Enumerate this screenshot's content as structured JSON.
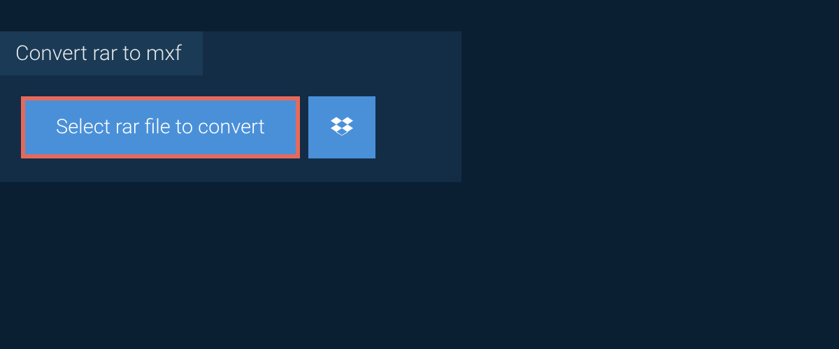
{
  "tab": {
    "title": "Convert rar to mxf"
  },
  "actions": {
    "select_file_label": "Select rar file to convert"
  },
  "colors": {
    "page_bg": "#0b1f33",
    "panel_bg": "#132d47",
    "tab_bg": "#1a3a56",
    "button_bg": "#4a90d9",
    "highlight_border": "#e36a5c",
    "text_light": "#ffffff"
  }
}
